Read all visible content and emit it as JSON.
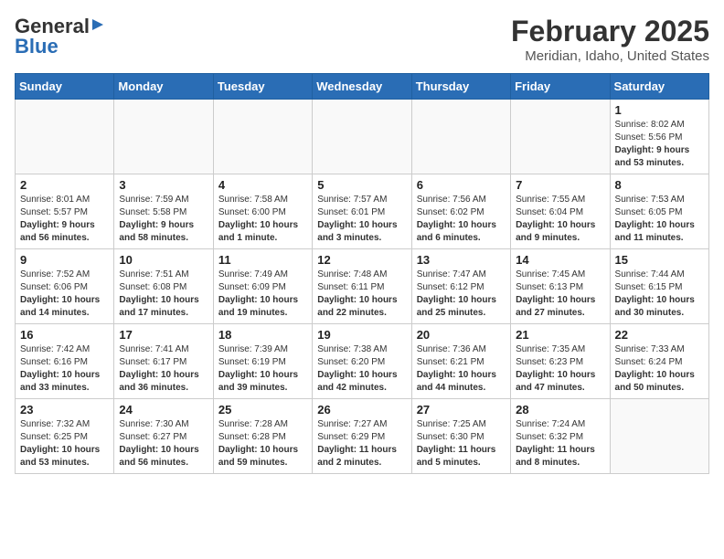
{
  "header": {
    "logo_general": "General",
    "logo_blue": "Blue",
    "month_title": "February 2025",
    "location": "Meridian, Idaho, United States"
  },
  "weekdays": [
    "Sunday",
    "Monday",
    "Tuesday",
    "Wednesday",
    "Thursday",
    "Friday",
    "Saturday"
  ],
  "weeks": [
    [
      {
        "day": "",
        "info": ""
      },
      {
        "day": "",
        "info": ""
      },
      {
        "day": "",
        "info": ""
      },
      {
        "day": "",
        "info": ""
      },
      {
        "day": "",
        "info": ""
      },
      {
        "day": "",
        "info": ""
      },
      {
        "day": "1",
        "info": "Sunrise: 8:02 AM\nSunset: 5:56 PM\nDaylight: 9 hours and 53 minutes."
      }
    ],
    [
      {
        "day": "2",
        "info": "Sunrise: 8:01 AM\nSunset: 5:57 PM\nDaylight: 9 hours and 56 minutes."
      },
      {
        "day": "3",
        "info": "Sunrise: 7:59 AM\nSunset: 5:58 PM\nDaylight: 9 hours and 58 minutes."
      },
      {
        "day": "4",
        "info": "Sunrise: 7:58 AM\nSunset: 6:00 PM\nDaylight: 10 hours and 1 minute."
      },
      {
        "day": "5",
        "info": "Sunrise: 7:57 AM\nSunset: 6:01 PM\nDaylight: 10 hours and 3 minutes."
      },
      {
        "day": "6",
        "info": "Sunrise: 7:56 AM\nSunset: 6:02 PM\nDaylight: 10 hours and 6 minutes."
      },
      {
        "day": "7",
        "info": "Sunrise: 7:55 AM\nSunset: 6:04 PM\nDaylight: 10 hours and 9 minutes."
      },
      {
        "day": "8",
        "info": "Sunrise: 7:53 AM\nSunset: 6:05 PM\nDaylight: 10 hours and 11 minutes."
      }
    ],
    [
      {
        "day": "9",
        "info": "Sunrise: 7:52 AM\nSunset: 6:06 PM\nDaylight: 10 hours and 14 minutes."
      },
      {
        "day": "10",
        "info": "Sunrise: 7:51 AM\nSunset: 6:08 PM\nDaylight: 10 hours and 17 minutes."
      },
      {
        "day": "11",
        "info": "Sunrise: 7:49 AM\nSunset: 6:09 PM\nDaylight: 10 hours and 19 minutes."
      },
      {
        "day": "12",
        "info": "Sunrise: 7:48 AM\nSunset: 6:11 PM\nDaylight: 10 hours and 22 minutes."
      },
      {
        "day": "13",
        "info": "Sunrise: 7:47 AM\nSunset: 6:12 PM\nDaylight: 10 hours and 25 minutes."
      },
      {
        "day": "14",
        "info": "Sunrise: 7:45 AM\nSunset: 6:13 PM\nDaylight: 10 hours and 27 minutes."
      },
      {
        "day": "15",
        "info": "Sunrise: 7:44 AM\nSunset: 6:15 PM\nDaylight: 10 hours and 30 minutes."
      }
    ],
    [
      {
        "day": "16",
        "info": "Sunrise: 7:42 AM\nSunset: 6:16 PM\nDaylight: 10 hours and 33 minutes."
      },
      {
        "day": "17",
        "info": "Sunrise: 7:41 AM\nSunset: 6:17 PM\nDaylight: 10 hours and 36 minutes."
      },
      {
        "day": "18",
        "info": "Sunrise: 7:39 AM\nSunset: 6:19 PM\nDaylight: 10 hours and 39 minutes."
      },
      {
        "day": "19",
        "info": "Sunrise: 7:38 AM\nSunset: 6:20 PM\nDaylight: 10 hours and 42 minutes."
      },
      {
        "day": "20",
        "info": "Sunrise: 7:36 AM\nSunset: 6:21 PM\nDaylight: 10 hours and 44 minutes."
      },
      {
        "day": "21",
        "info": "Sunrise: 7:35 AM\nSunset: 6:23 PM\nDaylight: 10 hours and 47 minutes."
      },
      {
        "day": "22",
        "info": "Sunrise: 7:33 AM\nSunset: 6:24 PM\nDaylight: 10 hours and 50 minutes."
      }
    ],
    [
      {
        "day": "23",
        "info": "Sunrise: 7:32 AM\nSunset: 6:25 PM\nDaylight: 10 hours and 53 minutes."
      },
      {
        "day": "24",
        "info": "Sunrise: 7:30 AM\nSunset: 6:27 PM\nDaylight: 10 hours and 56 minutes."
      },
      {
        "day": "25",
        "info": "Sunrise: 7:28 AM\nSunset: 6:28 PM\nDaylight: 10 hours and 59 minutes."
      },
      {
        "day": "26",
        "info": "Sunrise: 7:27 AM\nSunset: 6:29 PM\nDaylight: 11 hours and 2 minutes."
      },
      {
        "day": "27",
        "info": "Sunrise: 7:25 AM\nSunset: 6:30 PM\nDaylight: 11 hours and 5 minutes."
      },
      {
        "day": "28",
        "info": "Sunrise: 7:24 AM\nSunset: 6:32 PM\nDaylight: 11 hours and 8 minutes."
      },
      {
        "day": "",
        "info": ""
      }
    ]
  ]
}
